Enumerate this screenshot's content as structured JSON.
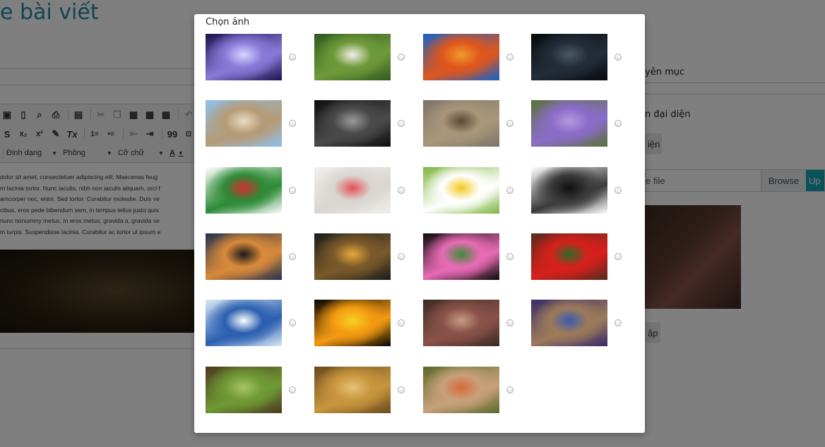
{
  "page": {
    "title": "e bài viết",
    "editor": {
      "toolbar_row2_icons": [
        "S",
        "x₂",
        "x²",
        "✎",
        "Tx",
        "1≡",
        "•≡",
        "⇤",
        "⇥",
        "99",
        "⊡"
      ],
      "format_label": "Định dạng",
      "font_label": "Phông",
      "size_label": "Cỡ chữ",
      "color_label": "A",
      "body_lines": [
        " dolor sit amet, consectetuer adipiscing elit. Maecenas feug",
        "m lacinia tortor. Nunc iaculis, nibh non iaculis aliquam, orci f",
        "amcorper nec, enim. Sed tortor. Curabitur molestie. Duis ve",
        "cibus, eros pede bibendum sem, in tempus tellus justo quis",
        " nunc nonummy metus. In eros metus, gravida a, gravida se",
        "m turpis. Suspendisse lacinia. Curabitur ac tortor ut ipsum e"
      ]
    },
    "sidebar": {
      "category_label": "yên mục",
      "featured_label": "n đại diện",
      "featured_button": "iện",
      "file_placeholder": "e file",
      "browse_label": "Browse",
      "upload_label": "Up",
      "bottom_button": "ập"
    }
  },
  "modal": {
    "title": "Chọn ảnh",
    "images": [
      {
        "name": "galaxy-image",
        "c1": "#1b1250",
        "c2": "#8a7ad8",
        "c3": "#d8d4ff"
      },
      {
        "name": "owl-image",
        "c1": "#2f5a1d",
        "c2": "#6f9a3b",
        "c3": "#f2f0e8"
      },
      {
        "name": "autumn-leaves-image",
        "c1": "#1762c4",
        "c2": "#e0561c",
        "c3": "#f39a2a"
      },
      {
        "name": "dark-knight-image",
        "c1": "#07090c",
        "c2": "#232d38",
        "c3": "#4b5866"
      },
      {
        "name": "beach-fort-image",
        "c1": "#8fc0e8",
        "c2": "#b59b77",
        "c3": "#e8dcc4"
      },
      {
        "name": "tunnel-image",
        "c1": "#0d0d0d",
        "c2": "#4a4a4a",
        "c3": "#9a9a9a"
      },
      {
        "name": "deer-image",
        "c1": "#7d7468",
        "c2": "#a9967a",
        "c3": "#5b4a35"
      },
      {
        "name": "thistle-flower-image",
        "c1": "#59733a",
        "c2": "#8b6cc9",
        "c3": "#b29ae0"
      },
      {
        "name": "christmas-icons-image",
        "c1": "#ffffff",
        "c2": "#2d8a36",
        "c3": "#d72d2d"
      },
      {
        "name": "map-image",
        "c1": "#f1efec",
        "c2": "#d9d6d2",
        "c3": "#e55050"
      },
      {
        "name": "daisy-image",
        "c1": "#7db63e",
        "c2": "#ffffff",
        "c3": "#f3c81b"
      },
      {
        "name": "dragon-image",
        "c1": "#ffffff",
        "c2": "#3a3a3a",
        "c3": "#101010"
      },
      {
        "name": "sunset-tree-image",
        "c1": "#24324d",
        "c2": "#d98a3a",
        "c3": "#1a1a1a"
      },
      {
        "name": "sunset-clouds-image",
        "c1": "#1b1b1b",
        "c2": "#7a5a2a",
        "c3": "#e8a83a"
      },
      {
        "name": "orchids-image",
        "c1": "#0a0a0a",
        "c2": "#e86bb5",
        "c3": "#3f8a3a"
      },
      {
        "name": "red-flowers-image",
        "c1": "#5a2a1e",
        "c2": "#d8201b",
        "c3": "#2f6a2a"
      },
      {
        "name": "blue-chairs-image",
        "c1": "#d9e8f5",
        "c2": "#2a5fb0",
        "c3": "#ffffff"
      },
      {
        "name": "oranges-image",
        "c1": "#050505",
        "c2": "#f59b12",
        "c3": "#f5d21e"
      },
      {
        "name": "girl-window-image",
        "c1": "#3b2a22",
        "c2": "#8a5249",
        "c3": "#c69a84"
      },
      {
        "name": "chihuahua-image",
        "c1": "#3a2a6a",
        "c2": "#9c7a5a",
        "c3": "#3b5bb0"
      },
      {
        "name": "grapes-image",
        "c1": "#4a3a1e",
        "c2": "#6f9a34",
        "c3": "#a8c468"
      },
      {
        "name": "wheat-field-image",
        "c1": "#6a4a1c",
        "c2": "#c8963e",
        "c3": "#e8c27a"
      },
      {
        "name": "bird-fence-image",
        "c1": "#5a6a2a",
        "c2": "#c8a07a",
        "c3": "#d86a3a"
      }
    ]
  }
}
